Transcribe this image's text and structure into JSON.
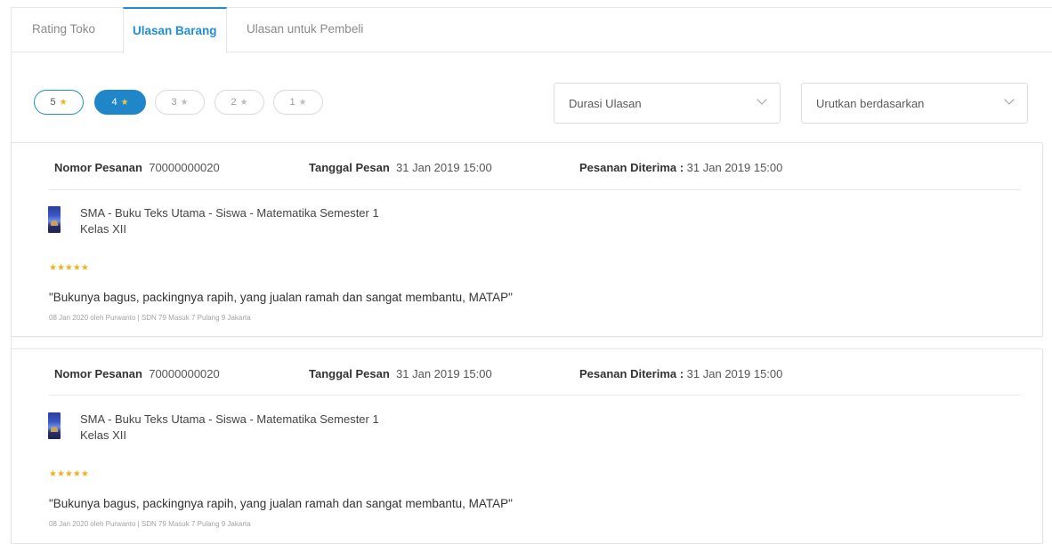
{
  "tabs": {
    "rating_toko": "Rating Toko",
    "ulasan_barang": "Ulasan Barang",
    "ulasan_pembeli": "Ulasan untuk Pembeli"
  },
  "rating_filters": [
    {
      "value": "5",
      "star": "★"
    },
    {
      "value": "4",
      "star": "★"
    },
    {
      "value": "3",
      "star": "★"
    },
    {
      "value": "2",
      "star": "★"
    },
    {
      "value": "1",
      "star": "★"
    }
  ],
  "filters": {
    "durasi_label": "Durasi Ulasan",
    "urutkan_label": "Urutkan berdasarkan"
  },
  "colors": {
    "accent": "#1f8fd6",
    "star": "#f2b01e"
  },
  "orders": [
    {
      "nomor_label": "Nomor Pesanan",
      "nomor_value": "70000000020",
      "tanggal_label": "Tanggal Pesan",
      "tanggal_value": "31 Jan 2019 15:00",
      "diterima_label": "Pesanan Diterima :",
      "diterima_value": "31 Jan 2019 15:00",
      "product_line1": "SMA - Buku Teks Utama - Siswa - Matematika Semester 1",
      "product_line2": "Kelas XII",
      "rating_stars": "★★★★★",
      "rating": 5,
      "review": "\"Bukunya bagus, packingnya rapih, yang jualan ramah dan sangat membantu, MATAP\"",
      "byline": "08 Jan 2020 oleh Purwanto | SDN 79 Masuk 7 Pulang 9 Jakarta"
    },
    {
      "nomor_label": "Nomor Pesanan",
      "nomor_value": "70000000020",
      "tanggal_label": "Tanggal Pesan",
      "tanggal_value": "31 Jan 2019 15:00",
      "diterima_label": "Pesanan Diterima :",
      "diterima_value": "31 Jan 2019 15:00",
      "product_line1": "SMA - Buku Teks Utama - Siswa - Matematika Semester 1",
      "product_line2": "Kelas XII",
      "rating_stars": "★★★★★",
      "rating": 5,
      "review": "\"Bukunya bagus, packingnya rapih, yang jualan ramah dan sangat membantu, MATAP\"",
      "byline": "08 Jan 2020 oleh Purwanto | SDN 79 Masuk 7 Pulang 9 Jakarta"
    }
  ]
}
